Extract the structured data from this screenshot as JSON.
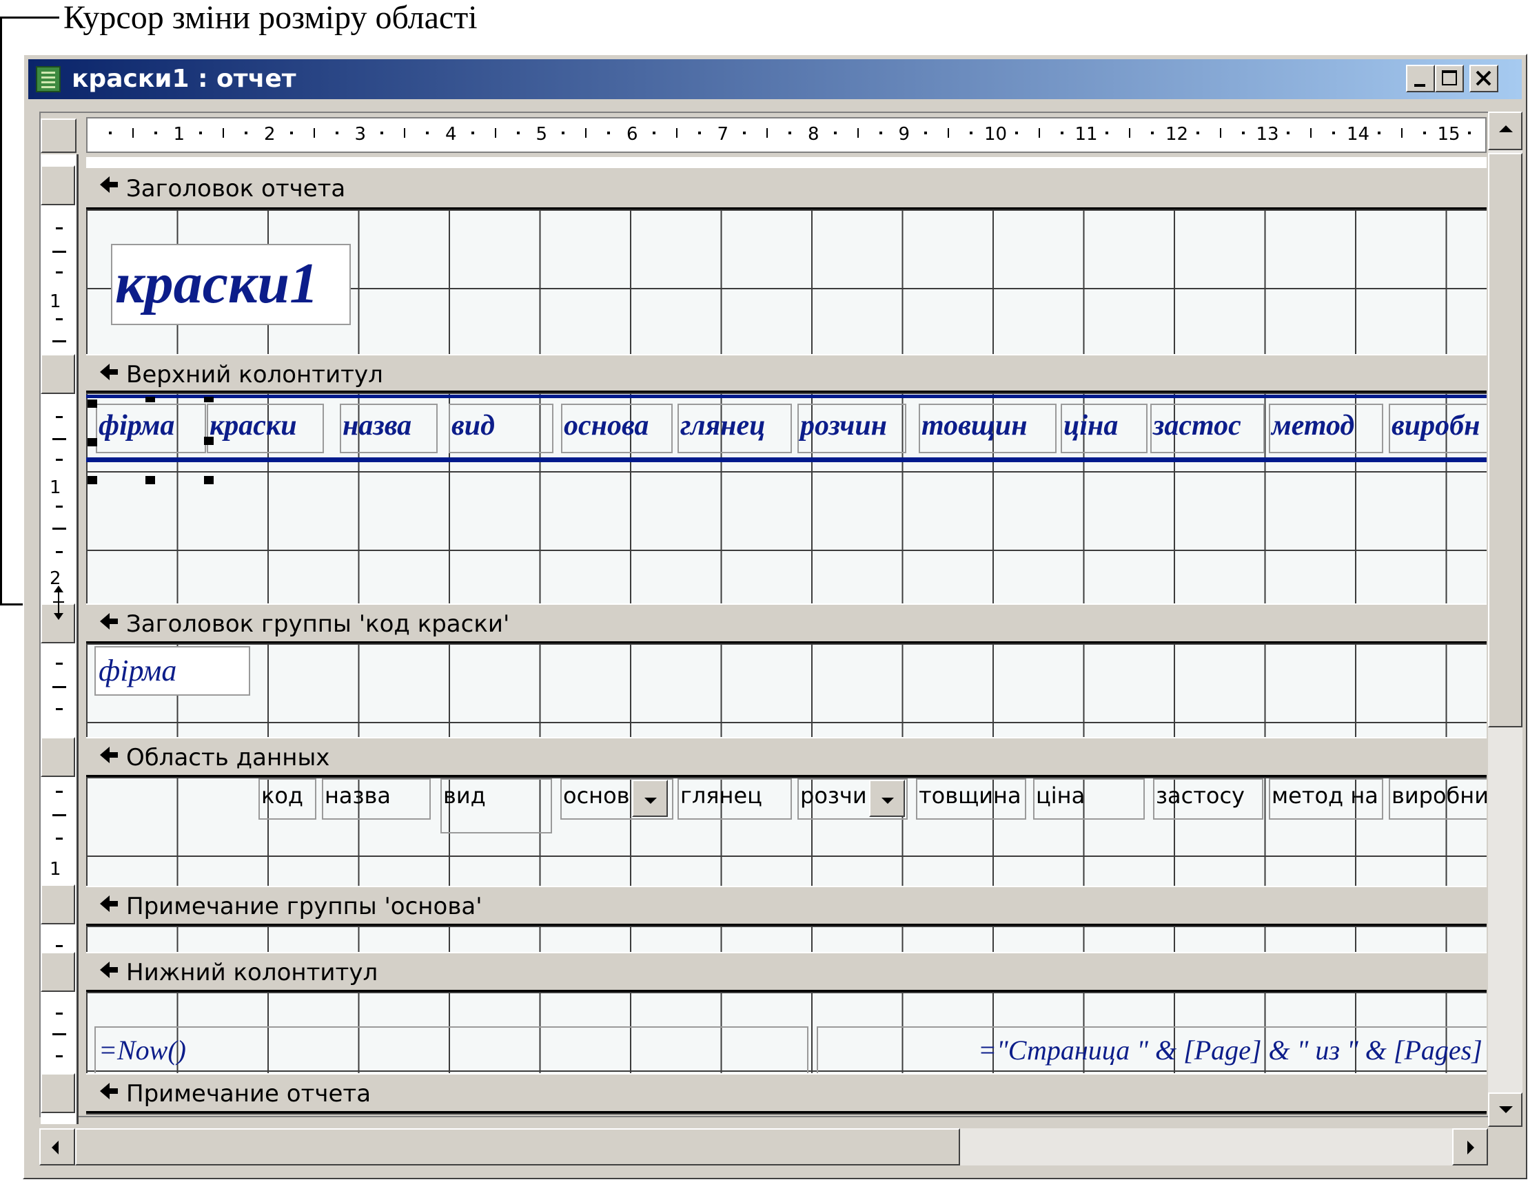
{
  "caption": {
    "text": "Курсор зміни розміру області"
  },
  "window": {
    "title": "краски1 : отчет",
    "buttons": [
      "minimize",
      "maximize",
      "close"
    ]
  },
  "ruler": {
    "numbers": [
      "1",
      "2",
      "3",
      "4",
      "5",
      "6",
      "7",
      "8",
      "9",
      "10",
      "11",
      "12",
      "13",
      "14",
      "15"
    ]
  },
  "vertical_ruler": {
    "labels": [
      "1",
      "1",
      "2",
      "1"
    ]
  },
  "sections": {
    "report_header": "Заголовок отчета",
    "page_header": "Верхний колонтитул",
    "group_header": "Заголовок группы 'код краски'",
    "detail": "Область данных",
    "group_footer": "Примечание группы 'основа'",
    "page_footer": "Нижний колонтитул",
    "report_footer": "Примечание отчета"
  },
  "report_title": "краски1",
  "page_header_labels": [
    "фірма",
    "краски",
    "назва",
    "вид",
    "основа",
    "глянец",
    "розчин",
    "товщин",
    "ціна",
    "застос",
    "метод",
    "виробн"
  ],
  "group_header_field": "фірма",
  "detail_fields": [
    "код",
    "назва",
    "вид",
    "основ",
    "глянец",
    "розчи",
    "товщина",
    "ціна",
    "застосу",
    "метод на",
    "виробни"
  ],
  "page_footer_fields": {
    "now": "=Now()",
    "page": "=\"Страница \" & [Page] & \" из \" & [Pages]"
  },
  "colors": {
    "title_bar_start": "#0a246a",
    "title_bar_end": "#a6caf0",
    "label_text": "#0c1d8a",
    "rule_line": "#001a8c"
  },
  "icons": {
    "window": "report-icon",
    "section_bar": "section-arrow-icon",
    "resize_cursor": "resize-cursor-icon"
  }
}
